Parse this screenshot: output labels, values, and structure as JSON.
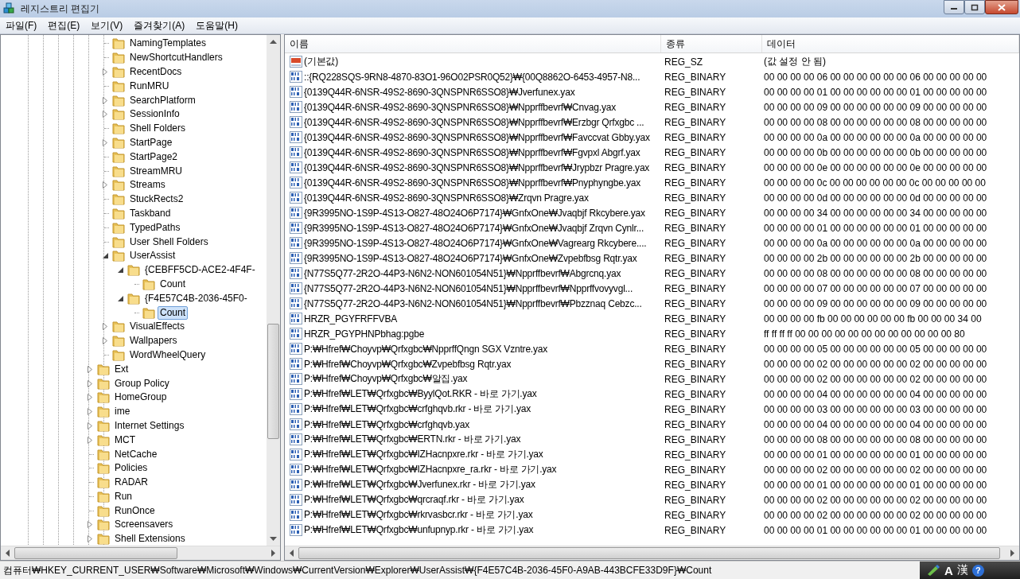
{
  "window": {
    "title": "레지스트리 편집기"
  },
  "menu": [
    "파일(F)",
    "편집(E)",
    "보기(V)",
    "즐겨찾기(A)",
    "도움말(H)"
  ],
  "tree": [
    {
      "children": [
        {
          "label": "NamingTemplates",
          "selected": false
        },
        {
          "label": "NewShortcutHandlers",
          "selected": false
        },
        {
          "label": "RecentDocs",
          "expanded": false,
          "selected": false
        },
        {
          "label": "RunMRU",
          "selected": false
        },
        {
          "label": "SearchPlatform",
          "expanded": false,
          "selected": false
        },
        {
          "label": "SessionInfo",
          "expanded": false,
          "selected": false
        },
        {
          "label": "Shell Folders",
          "selected": false
        },
        {
          "label": "StartPage",
          "expanded": false,
          "selected": false
        },
        {
          "label": "StartPage2",
          "selected": false
        },
        {
          "label": "StreamMRU",
          "selected": false
        },
        {
          "label": "Streams",
          "expanded": false,
          "selected": false
        },
        {
          "label": "StuckRects2",
          "selected": false
        },
        {
          "label": "Taskband",
          "selected": false
        },
        {
          "label": "TypedPaths",
          "selected": false
        },
        {
          "label": "User Shell Folders",
          "selected": false
        },
        {
          "label": "UserAssist",
          "expanded": true,
          "selected": false,
          "children": [
            {
              "label": "{CEBFF5CD-ACE2-4F4F-",
              "expanded": true,
              "selected": false,
              "children": [
                {
                  "label": "Count",
                  "selected": false
                }
              ]
            },
            {
              "label": "{F4E57C4B-2036-45F0-",
              "expanded": true,
              "selected": false,
              "children": [
                {
                  "label": "Count",
                  "selected": true
                }
              ]
            }
          ]
        },
        {
          "label": "VisualEffects",
          "expanded": false,
          "selected": false
        },
        {
          "label": "Wallpapers",
          "expanded": false,
          "selected": false
        },
        {
          "label": "WordWheelQuery",
          "selected": false
        }
      ]
    },
    {
      "label": "Ext",
      "expanded": false,
      "selected": false
    },
    {
      "label": "Group Policy",
      "expanded": false,
      "selected": false
    },
    {
      "label": "HomeGroup",
      "expanded": false,
      "selected": false
    },
    {
      "label": "ime",
      "expanded": false,
      "selected": false
    },
    {
      "label": "Internet Settings",
      "expanded": false,
      "selected": false
    },
    {
      "label": "MCT",
      "expanded": false,
      "selected": false
    },
    {
      "label": "NetCache",
      "selected": false
    },
    {
      "label": "Policies",
      "selected": false
    },
    {
      "label": "RADAR",
      "selected": false
    },
    {
      "label": "Run",
      "selected": false
    },
    {
      "label": "RunOnce",
      "selected": false
    },
    {
      "label": "Screensavers",
      "expanded": false,
      "selected": false
    },
    {
      "label": "Shell Extensions",
      "expanded": false,
      "selected": false
    }
  ],
  "columns": [
    "이름",
    "종류",
    "데이터"
  ],
  "values": [
    {
      "kind": "string",
      "name": "(기본값)",
      "type": "REG_SZ",
      "data": "(값 설정 안 됨)"
    },
    {
      "kind": "binary",
      "name": "::{RQ228SQS-9RN8-4870-83O1-96O02PSR0Q52}₩{00Q8862O-6453-4957-N8...",
      "type": "REG_BINARY",
      "data": "00 00 00 00 06 00 00 00 00 00 00 06 00 00 00 00 00"
    },
    {
      "kind": "binary",
      "name": "{0139Q44R-6NSR-49S2-8690-3QNSPNR6SSO8}₩Jverfunex.yax",
      "type": "REG_BINARY",
      "data": "00 00 00 00 01 00 00 00 00 00 00 01 00 00 00 00 00"
    },
    {
      "kind": "binary",
      "name": "{0139Q44R-6NSR-49S2-8690-3QNSPNR6SSO8}₩Npprffbevrf₩Cnvag.yax",
      "type": "REG_BINARY",
      "data": "00 00 00 00 09 00 00 00 00 00 00 09 00 00 00 00 00"
    },
    {
      "kind": "binary",
      "name": "{0139Q44R-6NSR-49S2-8690-3QNSPNR6SSO8}₩Npprffbevrf₩Erzbgr Qrfxgbc ...",
      "type": "REG_BINARY",
      "data": "00 00 00 00 08 00 00 00 00 00 00 08 00 00 00 00 00"
    },
    {
      "kind": "binary",
      "name": "{0139Q44R-6NSR-49S2-8690-3QNSPNR6SSO8}₩Npprffbevrf₩Favccvat Gbby.yax",
      "type": "REG_BINARY",
      "data": "00 00 00 00 0a 00 00 00 00 00 00 0a 00 00 00 00 00"
    },
    {
      "kind": "binary",
      "name": "{0139Q44R-6NSR-49S2-8690-3QNSPNR6SSO8}₩Npprffbevrf₩Fgvpxl Abgrf.yax",
      "type": "REG_BINARY",
      "data": "00 00 00 00 0b 00 00 00 00 00 00 0b 00 00 00 00 00"
    },
    {
      "kind": "binary",
      "name": "{0139Q44R-6NSR-49S2-8690-3QNSPNR6SSO8}₩Npprffbevrf₩Jrypbzr Pragre.yax",
      "type": "REG_BINARY",
      "data": "00 00 00 00 0e 00 00 00 00 00 00 0e 00 00 00 00 00"
    },
    {
      "kind": "binary",
      "name": "{0139Q44R-6NSR-49S2-8690-3QNSPNR6SSO8}₩Npprffbevrf₩Pnyphyngbe.yax",
      "type": "REG_BINARY",
      "data": "00 00 00 00 0c 00 00 00 00 00 00 0c 00 00 00 00 00"
    },
    {
      "kind": "binary",
      "name": "{0139Q44R-6NSR-49S2-8690-3QNSPNR6SSO8}₩Zrqvn Pragre.yax",
      "type": "REG_BINARY",
      "data": "00 00 00 00 0d 00 00 00 00 00 00 0d 00 00 00 00 00"
    },
    {
      "kind": "binary",
      "name": "{9R3995NO-1S9P-4S13-O827-48O24O6P7174}₩GnfxOne₩Jvaqbjf Rkcybere.yax",
      "type": "REG_BINARY",
      "data": "00 00 00 00 34 00 00 00 00 00 00 34 00 00 00 00 00"
    },
    {
      "kind": "binary",
      "name": "{9R3995NO-1S9P-4S13-O827-48O24O6P7174}₩GnfxOne₩Jvaqbjf Zrqvn Cynlr...",
      "type": "REG_BINARY",
      "data": "00 00 00 00 01 00 00 00 00 00 00 01 00 00 00 00 00"
    },
    {
      "kind": "binary",
      "name": "{9R3995NO-1S9P-4S13-O827-48O24O6P7174}₩GnfxOne₩Vagrearg Rkcybere....",
      "type": "REG_BINARY",
      "data": "00 00 00 00 0a 00 00 00 00 00 00 0a 00 00 00 00 00"
    },
    {
      "kind": "binary",
      "name": "{9R3995NO-1S9P-4S13-O827-48O24O6P7174}₩GnfxOne₩Zvpebfbsg Rqtr.yax",
      "type": "REG_BINARY",
      "data": "00 00 00 00 2b 00 00 00 00 00 00 2b 00 00 00 00 00"
    },
    {
      "kind": "binary",
      "name": "{N77S5Q77-2R2O-44P3-N6N2-NON601054N51}₩Npprffbevrf₩Abgrcnq.yax",
      "type": "REG_BINARY",
      "data": "00 00 00 00 08 00 00 00 00 00 00 08 00 00 00 00 00"
    },
    {
      "kind": "binary",
      "name": "{N77S5Q77-2R2O-44P3-N6N2-NON601054N51}₩Npprffbevrf₩Npprffvovyvgl...",
      "type": "REG_BINARY",
      "data": "00 00 00 00 07 00 00 00 00 00 00 07 00 00 00 00 00"
    },
    {
      "kind": "binary",
      "name": "{N77S5Q77-2R2O-44P3-N6N2-NON601054N51}₩Npprffbevrf₩Pbzznaq Cebzc...",
      "type": "REG_BINARY",
      "data": "00 00 00 00 09 00 00 00 00 00 00 09 00 00 00 00 00"
    },
    {
      "kind": "binary",
      "name": "HRZR_PGYFRFFVBA",
      "type": "REG_BINARY",
      "data": "00 00 00 00 fb 00 00 00 00 00 00 fb 00 00 00 34 00"
    },
    {
      "kind": "binary",
      "name": "HRZR_PGYPHNPbhag:pgbe",
      "type": "REG_BINARY",
      "data": "ff ff ff ff 00 00 00 00 00 00 00 00 00 00 00 00 80"
    },
    {
      "kind": "binary",
      "name": "P:₩Hfref₩Choyvp₩Qrfxgbc₩NpprffQngn SGX Vzntre.yax",
      "type": "REG_BINARY",
      "data": "00 00 00 00 05 00 00 00 00 00 00 05 00 00 00 00 00"
    },
    {
      "kind": "binary",
      "name": "P:₩Hfref₩Choyvp₩Qrfxgbc₩Zvpebfbsg Rqtr.yax",
      "type": "REG_BINARY",
      "data": "00 00 00 00 02 00 00 00 00 00 00 02 00 00 00 00 00"
    },
    {
      "kind": "binary",
      "name": "P:₩Hfref₩Choyvp₩Qrfxgbc₩알집.yax",
      "type": "REG_BINARY",
      "data": "00 00 00 00 02 00 00 00 00 00 00 02 00 00 00 00 00"
    },
    {
      "kind": "binary",
      "name": "P:₩Hfref₩LET₩Qrfxgbc₩ByylQot.RKR - 바로 가기.yax",
      "type": "REG_BINARY",
      "data": "00 00 00 00 04 00 00 00 00 00 00 04 00 00 00 00 00"
    },
    {
      "kind": "binary",
      "name": "P:₩Hfref₩LET₩Qrfxgbc₩crfghqvb.rkr - 바로 가기.yax",
      "type": "REG_BINARY",
      "data": "00 00 00 00 03 00 00 00 00 00 00 03 00 00 00 00 00"
    },
    {
      "kind": "binary",
      "name": "P:₩Hfref₩LET₩Qrfxgbc₩crfghqvb.yax",
      "type": "REG_BINARY",
      "data": "00 00 00 00 04 00 00 00 00 00 00 04 00 00 00 00 00"
    },
    {
      "kind": "binary",
      "name": "P:₩Hfref₩LET₩Qrfxgbc₩ERTN.rkr - 바로 가기.yax",
      "type": "REG_BINARY",
      "data": "00 00 00 00 08 00 00 00 00 00 00 08 00 00 00 00 00"
    },
    {
      "kind": "binary",
      "name": "P:₩Hfref₩LET₩Qrfxgbc₩IZHacnpxre.rkr - 바로 가기.yax",
      "type": "REG_BINARY",
      "data": "00 00 00 00 01 00 00 00 00 00 00 01 00 00 00 00 00"
    },
    {
      "kind": "binary",
      "name": "P:₩Hfref₩LET₩Qrfxgbc₩IZHacnpxre_ra.rkr - 바로 가기.yax",
      "type": "REG_BINARY",
      "data": "00 00 00 00 02 00 00 00 00 00 00 02 00 00 00 00 00"
    },
    {
      "kind": "binary",
      "name": "P:₩Hfref₩LET₩Qrfxgbc₩Jverfunex.rkr - 바로 가기.yax",
      "type": "REG_BINARY",
      "data": "00 00 00 00 01 00 00 00 00 00 00 01 00 00 00 00 00"
    },
    {
      "kind": "binary",
      "name": "P:₩Hfref₩LET₩Qrfxgbc₩qrcraqf.rkr - 바로 가기.yax",
      "type": "REG_BINARY",
      "data": "00 00 00 00 02 00 00 00 00 00 00 02 00 00 00 00 00"
    },
    {
      "kind": "binary",
      "name": "P:₩Hfref₩LET₩Qrfxgbc₩rkrvasbcr.rkr - 바로 가기.yax",
      "type": "REG_BINARY",
      "data": "00 00 00 00 02 00 00 00 00 00 00 02 00 00 00 00 00"
    },
    {
      "kind": "binary",
      "name": "P:₩Hfref₩LET₩Qrfxgbc₩unfupnyp.rkr - 바로 가기.yax",
      "type": "REG_BINARY",
      "data": "00 00 00 00 01 00 00 00 00 00 00 01 00 00 00 00 00"
    }
  ],
  "status_bar": {
    "path": "컴퓨터₩HKEY_CURRENT_USER₩Software₩Microsoft₩Windows₩CurrentVersion₩Explorer₩UserAssist₩{F4E57C4B-2036-45F0-A9AB-443BCFE33D9F}₩Count"
  },
  "language_bar": {
    "mode": "A",
    "hanja": "漢",
    "help": "?"
  }
}
